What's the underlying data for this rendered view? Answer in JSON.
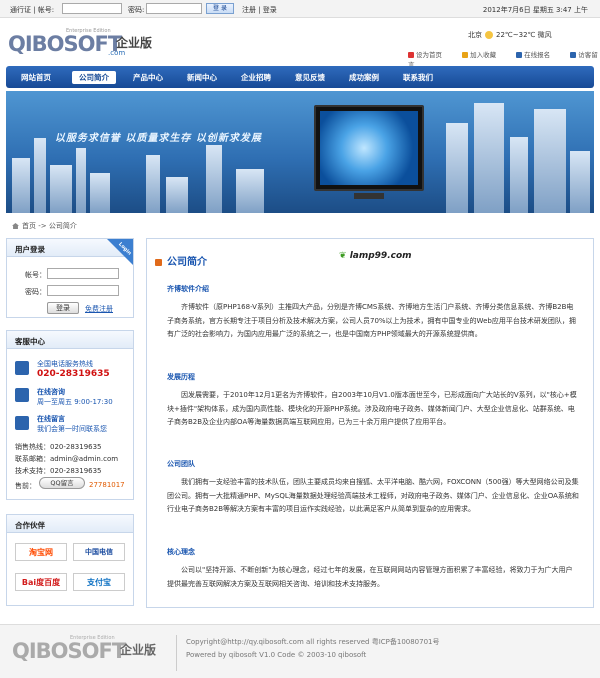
{
  "topbar": {
    "passport_label": "通行证 | 帐号:",
    "password_label": "密码:",
    "login_btn": "登 录",
    "links": "注册 | 登录",
    "date": "2012年7月6日 星期五 3:47 上午"
  },
  "header": {
    "logo_main": "QIBOSOFT",
    "logo_sub": "Enterprise Edition",
    "logo_cn": "企业版",
    "logo_com": ".com",
    "city": "北京",
    "weather": "22℃~32℃ 微风",
    "quick_links": [
      "设为首页",
      "加入收藏",
      "在线报名",
      "访客留言"
    ]
  },
  "nav": {
    "items": [
      "网站首页",
      "公司简介",
      "产品中心",
      "新闻中心",
      "企业招聘",
      "意见反馈",
      "成功案例",
      "联系我们"
    ]
  },
  "banner": {
    "slogan": "以服务求信誉 以质量求生存 以创新求发展"
  },
  "breadcrumb": "首页 -> 公司简介",
  "login": {
    "title": "用户登录",
    "tag": "Login",
    "account": "帐号：",
    "password": "密码：",
    "login_btn": "登录",
    "register": "免费注册"
  },
  "service": {
    "title": "客服中心",
    "hotline_label": "全国电话服务热线",
    "hotline": "020-28319635",
    "consult_title": "在线咨询",
    "consult_sub": "周一至周五 9:00-17:30",
    "msg_title": "在线留言",
    "msg_sub": "我们会第一时间联系您",
    "sales": "销售热线：020-28319635",
    "email": "联系邮箱：admin@admin.com",
    "support": "技术支持：020-28319635",
    "qq_label": "售前：",
    "qq_badge": "QQ留言",
    "qq": "27781017"
  },
  "partners": {
    "title": "合作伙伴",
    "items": [
      "淘宝网",
      "中国电信",
      "Bai度百度",
      "支付宝"
    ]
  },
  "main": {
    "title": "公司简介",
    "logo_text": "lamp99.com",
    "sections": [
      {
        "heading": "齐博软件介绍",
        "text": "齐博软件（原PHP168-V系列）主推四大产品，分别是齐博CMS系统、齐博地方生活门户系统、齐博分类信息系统、齐博B2B电子商务系统，官方长期专注于项目分析及技术解决方案，公司人员70%以上为技术，拥有中国专业的Web应用平台技术研发团队，拥有广泛的社会影响力，为国内应用最广泛的系统之一，也是中国南方PHP领域最大的开源系统提供商。"
      },
      {
        "heading": "发展历程",
        "text": "因发展需要，于2010年12月1更名为齐博软件，自2003年10月V1.0版本面世至今，已形成面向广大站长的V系列，以\"核心+模块+插件\"架构体系，成为国内高性能、模块化的开源PHP系统。涉及政府电子政务、媒体新闻门户、大型企业信息化、站群系统、电子商务B2B及企业内部OA等海量数据高端互联网应用，已为三十余万用户提供了应用平台。"
      },
      {
        "heading": "公司团队",
        "text": "我们拥有一支经验丰富的技术队伍，团队主要成员均来自搜狐、太平洋电脑、酷六网，FOXCONN（500强）等大型网络公司及集团公司。拥有一大批精通PHP、MySQL海量数据处理经验高端技术工程师，对政府电子政务、媒体门户、企业信息化、企业OA系统和行业电子商务B2B等解决方案有丰富的项目运作实践经验，以此满足客户从简单到复杂的应用需求。"
      },
      {
        "heading": "核心理念",
        "text": "公司以\"坚持开源、不断创新\"为核心理念，经过七年的发展，在互联网网站内容管理方面积累了丰富经验，将致力于为广大用户提供最完善互联网解决方案及互联网相关咨询、培训和技术支持服务。"
      }
    ]
  },
  "footer": {
    "line1": "Copyright@http://qy.qibosoft.com all rights reserved 粤ICP备10080701号",
    "line2": "Powered by qibosoft V1.0 Code © 2003-10 qibosoft"
  }
}
